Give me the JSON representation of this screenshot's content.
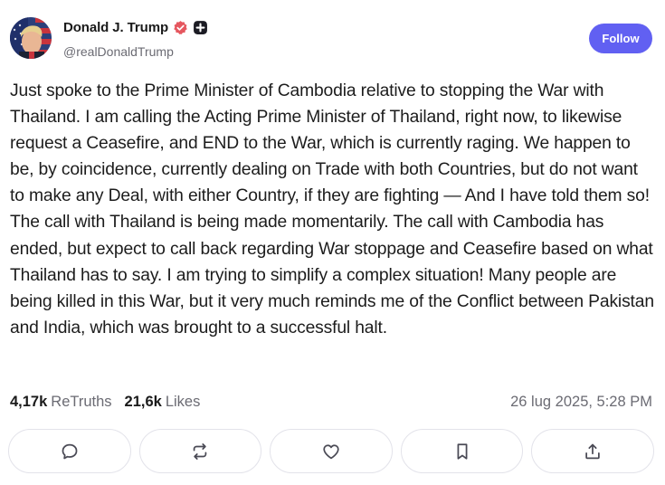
{
  "author": {
    "name": "Donald J. Trump",
    "handle": "@realDonaldTrump",
    "verified_icon": "verified-badge-icon",
    "extra_icon": "plus-badge-icon"
  },
  "follow_label": "Follow",
  "post": {
    "text": "Just spoke to the Prime Minister of Cambodia relative to stopping the War with Thailand. I am calling the Acting Prime Minister of Thailand, right now, to likewise request a Ceasefire, and END to the War, which is currently raging. We happen to be, by coincidence, currently dealing on Trade with both Countries, but do not want to make any Deal, with either Country, if they are fighting — And I have told them so! The call with Thailand is being made momentarily. The call with Cambodia has ended, but expect to call back regarding War stoppage and Ceasefire based on what Thailand has to say. I am trying to simplify a complex situation! Many people are being killed in this War, but it very much reminds me of the Conflict between Pakistan and India, which was brought to a successful halt."
  },
  "stats": {
    "retruths_count": "4,17k",
    "retruths_label": "ReTruths",
    "likes_count": "21,6k",
    "likes_label": "Likes",
    "timestamp": "26 lug 2025, 5:28 PM"
  },
  "actions": [
    "comment-icon",
    "retruth-icon",
    "heart-icon",
    "bookmark-icon",
    "share-icon"
  ],
  "colors": {
    "accent": "#6160f2",
    "verified": "#e5575f",
    "muted_text": "#6b6b73",
    "border": "#e3e3ea"
  }
}
